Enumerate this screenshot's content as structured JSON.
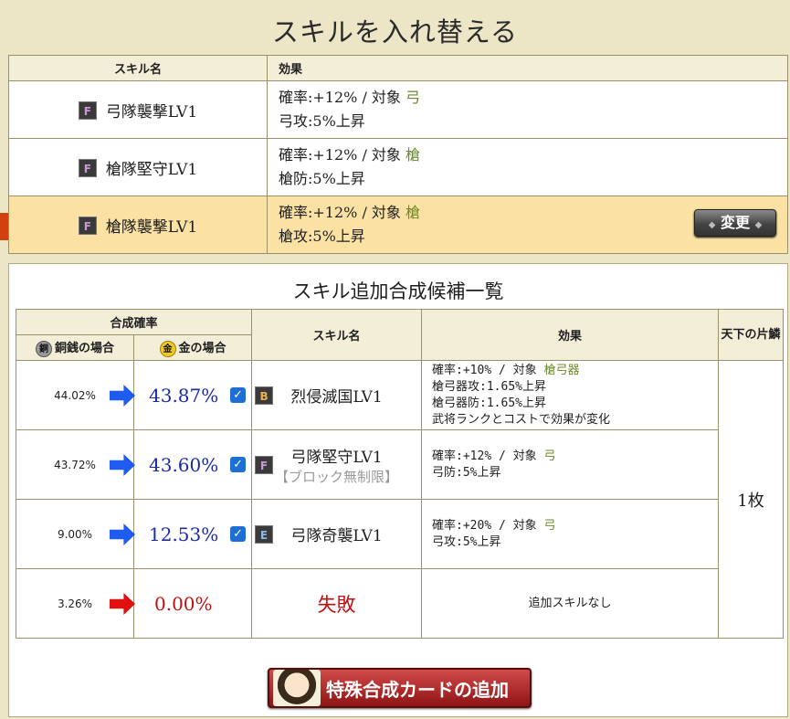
{
  "title": "スキルを入れ替える",
  "current": {
    "headers": {
      "name": "スキル名",
      "effect": "効果"
    },
    "rows": [
      {
        "rank": "F",
        "name": "弓隊襲撃LV1",
        "line1_prefix": "確率:+12% / 対象",
        "target": "弓",
        "line2": "弓攻:5%上昇"
      },
      {
        "rank": "F",
        "name": "槍隊堅守LV1",
        "line1_prefix": "確率:+12% / 対象",
        "target": "槍",
        "line2": "槍防:5%上昇"
      },
      {
        "rank": "F",
        "name": "槍隊襲撃LV1",
        "line1_prefix": "確率:+12% / 対象",
        "target": "槍",
        "line2": "槍攻:5%上昇"
      }
    ],
    "change_label": "変更"
  },
  "candidates": {
    "title": "スキル追加合成候補一覧",
    "headers": {
      "rate": "合成確率",
      "copper": "銅銭の場合",
      "gold": "金の場合",
      "copper_coin": "銅",
      "gold_coin": "金",
      "name": "スキル名",
      "effect": "効果",
      "scale": "天下の片鱗"
    },
    "rows": [
      {
        "copper": "44.02%",
        "gold": "43.87%",
        "rank": "B",
        "name": "烈侵滅国LV1",
        "sub": "",
        "e1": "確率:+10% / 対象",
        "target": "槍弓器",
        "e2": "槍弓器攻:1.65%上昇",
        "e3": "槍弓器防:1.65%上昇",
        "e4": "武将ランクとコストで効果が変化"
      },
      {
        "copper": "43.72%",
        "gold": "43.60%",
        "rank": "F",
        "name": "弓隊堅守LV1",
        "sub": "【ブロック無制限】",
        "e1": "確率:+12% / 対象",
        "target": "弓",
        "e2": "弓防:5%上昇"
      },
      {
        "copper": "9.00%",
        "gold": "12.53%",
        "rank": "E",
        "name": "弓隊奇襲LV1",
        "sub": "",
        "e1": "確率:+20% / 対象",
        "target": "弓",
        "e2": "弓攻:5%上昇"
      },
      {
        "copper": "3.26%",
        "gold": "0.00%",
        "name": "失敗",
        "effect": "追加スキルなし"
      }
    ],
    "scale_value": "1枚"
  },
  "special_button": "特殊合成カードの追加",
  "colors": {
    "background": "#ece6c6",
    "selected_row": "#fbe2a4",
    "rate_blue": "#1a2aa8",
    "fail_red": "#c01010",
    "target_green": "#6a8a2a"
  }
}
